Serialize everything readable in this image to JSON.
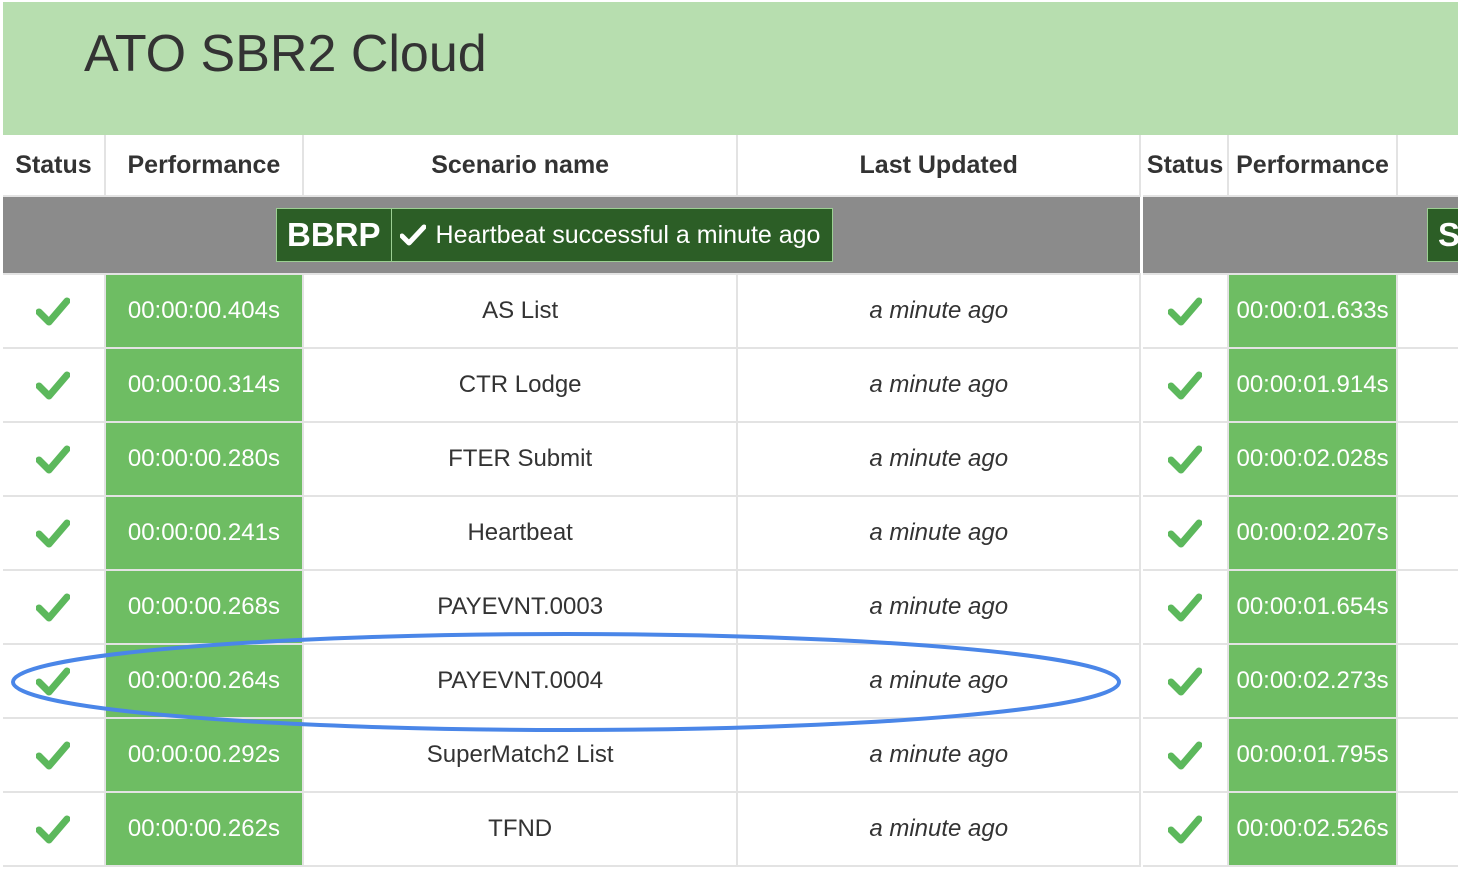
{
  "header": {
    "title": "ATO SBR2 Cloud"
  },
  "columns": {
    "status": "Status",
    "performance": "Performance",
    "scenario": "Scenario name",
    "last_updated": "Last Updated"
  },
  "left_group": {
    "name": "BBRP",
    "heartbeat": "Heartbeat successful a minute ago",
    "rows": [
      {
        "perf": "00:00:00.404s",
        "scenario": "AS List",
        "updated": "a minute ago"
      },
      {
        "perf": "00:00:00.314s",
        "scenario": "CTR Lodge",
        "updated": "a minute ago"
      },
      {
        "perf": "00:00:00.280s",
        "scenario": "FTER Submit",
        "updated": "a minute ago"
      },
      {
        "perf": "00:00:00.241s",
        "scenario": "Heartbeat",
        "updated": "a minute ago"
      },
      {
        "perf": "00:00:00.268s",
        "scenario": "PAYEVNT.0003",
        "updated": "a minute ago"
      },
      {
        "perf": "00:00:00.264s",
        "scenario": "PAYEVNT.0004",
        "updated": "a minute ago"
      },
      {
        "perf": "00:00:00.292s",
        "scenario": "SuperMatch2 List",
        "updated": "a minute ago"
      },
      {
        "perf": "00:00:00.262s",
        "scenario": "TFND",
        "updated": "a minute ago"
      }
    ]
  },
  "right_group": {
    "name_partial": "S",
    "rows": [
      {
        "perf": "00:00:01.633s"
      },
      {
        "perf": "00:00:01.914s"
      },
      {
        "perf": "00:00:02.028s"
      },
      {
        "perf": "00:00:02.207s"
      },
      {
        "perf": "00:00:01.654s"
      },
      {
        "perf": "00:00:02.273s"
      },
      {
        "perf": "00:00:01.795s"
      },
      {
        "perf": "00:00:02.526s"
      }
    ]
  },
  "colors": {
    "header_bg": "#b7deaf",
    "perf_bg": "#6ebd63",
    "check": "#5cb85c",
    "group_bar": "#8b8b8b",
    "badge_bg": "#2c5e26",
    "highlight_ring": "#4a86e8"
  },
  "icons": {
    "status": "check-icon",
    "badge": "check-icon"
  }
}
